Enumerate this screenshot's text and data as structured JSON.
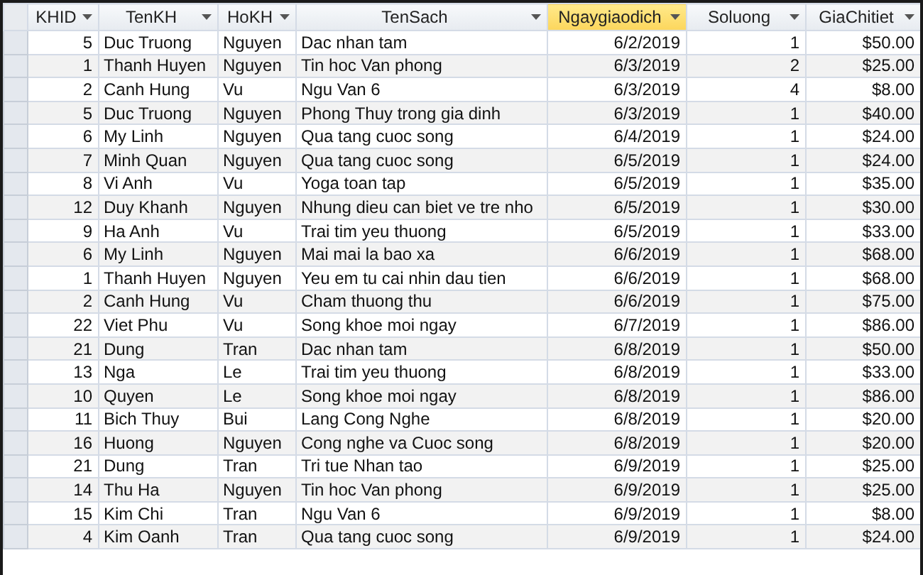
{
  "table": {
    "columns": [
      {
        "label": "KHID",
        "selected": false,
        "kind": "number"
      },
      {
        "label": "TenKH",
        "selected": false,
        "kind": "text"
      },
      {
        "label": "HoKH",
        "selected": false,
        "kind": "text"
      },
      {
        "label": "TenSach",
        "selected": false,
        "kind": "text"
      },
      {
        "label": "Ngaygiaodich",
        "selected": true,
        "kind": "date"
      },
      {
        "label": "Soluong",
        "selected": false,
        "kind": "number"
      },
      {
        "label": "GiaChitiet",
        "selected": false,
        "kind": "currency"
      }
    ],
    "rows": [
      [
        "5",
        "Duc Truong",
        "Nguyen",
        "Dac nhan tam",
        "6/2/2019",
        "1",
        "$50.00"
      ],
      [
        "1",
        "Thanh Huyen",
        "Nguyen",
        "Tin hoc Van phong",
        "6/3/2019",
        "2",
        "$25.00"
      ],
      [
        "2",
        "Canh Hung",
        "Vu",
        "Ngu Van 6",
        "6/3/2019",
        "4",
        "$8.00"
      ],
      [
        "5",
        "Duc Truong",
        "Nguyen",
        "Phong Thuy trong gia dinh",
        "6/3/2019",
        "1",
        "$40.00"
      ],
      [
        "6",
        "My Linh",
        "Nguyen",
        "Qua tang cuoc song",
        "6/4/2019",
        "1",
        "$24.00"
      ],
      [
        "7",
        "Minh Quan",
        "Nguyen",
        "Qua tang cuoc song",
        "6/5/2019",
        "1",
        "$24.00"
      ],
      [
        "8",
        "Vi Anh",
        "Vu",
        "Yoga toan tap",
        "6/5/2019",
        "1",
        "$35.00"
      ],
      [
        "12",
        "Duy Khanh",
        "Nguyen",
        "Nhung dieu can biet ve tre nho",
        "6/5/2019",
        "1",
        "$30.00"
      ],
      [
        "9",
        "Ha Anh",
        "Vu",
        "Trai tim yeu thuong",
        "6/5/2019",
        "1",
        "$33.00"
      ],
      [
        "6",
        "My Linh",
        "Nguyen",
        "Mai mai la bao xa",
        "6/6/2019",
        "1",
        "$68.00"
      ],
      [
        "1",
        "Thanh Huyen",
        "Nguyen",
        "Yeu em tu cai nhin dau tien",
        "6/6/2019",
        "1",
        "$68.00"
      ],
      [
        "2",
        "Canh Hung",
        "Vu",
        "Cham thuong thu",
        "6/6/2019",
        "1",
        "$75.00"
      ],
      [
        "22",
        "Viet Phu",
        "Vu",
        "Song khoe moi ngay",
        "6/7/2019",
        "1",
        "$86.00"
      ],
      [
        "21",
        "Dung",
        "Tran",
        "Dac nhan tam",
        "6/8/2019",
        "1",
        "$50.00"
      ],
      [
        "13",
        "Nga",
        "Le",
        "Trai tim yeu thuong",
        "6/8/2019",
        "1",
        "$33.00"
      ],
      [
        "10",
        "Quyen",
        "Le",
        "Song khoe moi ngay",
        "6/8/2019",
        "1",
        "$86.00"
      ],
      [
        "11",
        "Bich Thuy",
        "Bui",
        "Lang Cong Nghe",
        "6/8/2019",
        "1",
        "$20.00"
      ],
      [
        "16",
        "Huong",
        "Nguyen",
        "Cong nghe va Cuoc song",
        "6/8/2019",
        "1",
        "$20.00"
      ],
      [
        "21",
        "Dung",
        "Tran",
        "Tri tue Nhan tao",
        "6/9/2019",
        "1",
        "$25.00"
      ],
      [
        "14",
        "Thu Ha",
        "Nguyen",
        "Tin hoc Van phong",
        "6/9/2019",
        "1",
        "$25.00"
      ],
      [
        "15",
        "Kim Chi",
        "Tran",
        "Ngu Van 6",
        "6/9/2019",
        "1",
        "$8.00"
      ],
      [
        "4",
        "Kim Oanh",
        "Tran",
        "Qua tang cuoc song",
        "6/9/2019",
        "1",
        "$24.00"
      ]
    ]
  }
}
